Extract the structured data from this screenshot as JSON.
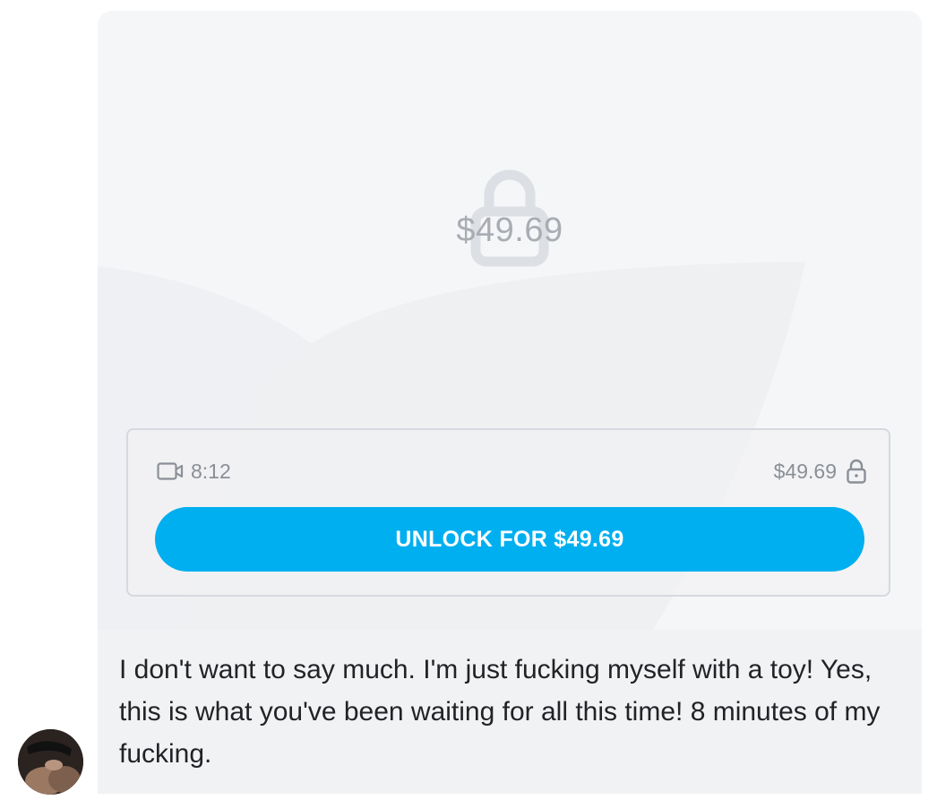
{
  "media": {
    "center_price": "$49.69"
  },
  "card": {
    "duration": "8:12",
    "price": "$49.69",
    "unlock_label": "UNLOCK FOR $49.69"
  },
  "message": {
    "text": "I don't want to say much. I'm just fucking myself with a toy! Yes, this is what you've been waiting for all this time! 8 minutes of my fucking."
  },
  "colors": {
    "accent": "#00aff0",
    "bubble_bg": "#f1f2f4",
    "muted_text": "#8a8f97"
  },
  "icons": [
    "lock-icon",
    "video-camera-icon",
    "small-lock-icon",
    "avatar"
  ]
}
